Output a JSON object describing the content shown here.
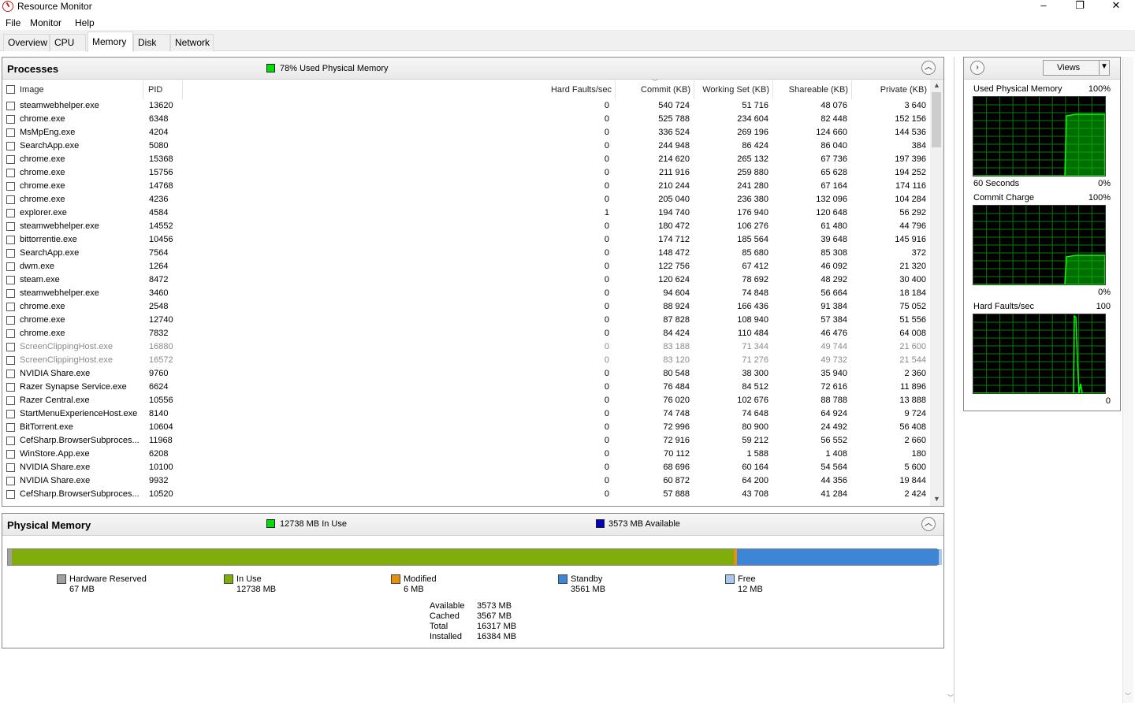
{
  "app": {
    "title": "Resource Monitor"
  },
  "window_controls": {
    "minimize": "–",
    "maximize": "❐",
    "close": "✕"
  },
  "menu": [
    "File",
    "Monitor",
    "Help"
  ],
  "tabs": [
    "Overview",
    "CPU",
    "Memory",
    "Disk",
    "Network"
  ],
  "active_tab": "Memory",
  "processes": {
    "title": "Processes",
    "status_text": "78% Used Physical Memory",
    "status_color": "#00e000",
    "columns": {
      "image": "Image",
      "pid": "PID",
      "hard_faults": "Hard Faults/sec",
      "commit": "Commit (KB)",
      "working_set": "Working Set (KB)",
      "shareable": "Shareable (KB)",
      "private": "Private (KB)"
    },
    "rows": [
      {
        "image": "steamwebhelper.exe",
        "pid": "13620",
        "hf": "0",
        "commit": "540 724",
        "ws": "51 716",
        "share": "48 076",
        "priv": "3 640",
        "dim": false
      },
      {
        "image": "chrome.exe",
        "pid": "6348",
        "hf": "0",
        "commit": "525 788",
        "ws": "234 604",
        "share": "82 448",
        "priv": "152 156",
        "dim": false
      },
      {
        "image": "MsMpEng.exe",
        "pid": "4204",
        "hf": "0",
        "commit": "336 524",
        "ws": "269 196",
        "share": "124 660",
        "priv": "144 536",
        "dim": false
      },
      {
        "image": "SearchApp.exe",
        "pid": "5080",
        "hf": "0",
        "commit": "244 948",
        "ws": "86 424",
        "share": "86 040",
        "priv": "384",
        "dim": false
      },
      {
        "image": "chrome.exe",
        "pid": "15368",
        "hf": "0",
        "commit": "214 620",
        "ws": "265 132",
        "share": "67 736",
        "priv": "197 396",
        "dim": false
      },
      {
        "image": "chrome.exe",
        "pid": "15756",
        "hf": "0",
        "commit": "211 916",
        "ws": "259 880",
        "share": "65 628",
        "priv": "194 252",
        "dim": false
      },
      {
        "image": "chrome.exe",
        "pid": "14768",
        "hf": "0",
        "commit": "210 244",
        "ws": "241 280",
        "share": "67 164",
        "priv": "174 116",
        "dim": false
      },
      {
        "image": "chrome.exe",
        "pid": "4236",
        "hf": "0",
        "commit": "205 040",
        "ws": "236 380",
        "share": "132 096",
        "priv": "104 284",
        "dim": false
      },
      {
        "image": "explorer.exe",
        "pid": "4584",
        "hf": "1",
        "commit": "194 740",
        "ws": "176 940",
        "share": "120 648",
        "priv": "56 292",
        "dim": false
      },
      {
        "image": "steamwebhelper.exe",
        "pid": "14552",
        "hf": "0",
        "commit": "180 472",
        "ws": "106 276",
        "share": "61 480",
        "priv": "44 796",
        "dim": false
      },
      {
        "image": "bittorrentie.exe",
        "pid": "10456",
        "hf": "0",
        "commit": "174 712",
        "ws": "185 564",
        "share": "39 648",
        "priv": "145 916",
        "dim": false
      },
      {
        "image": "SearchApp.exe",
        "pid": "7564",
        "hf": "0",
        "commit": "148 472",
        "ws": "85 680",
        "share": "85 308",
        "priv": "372",
        "dim": false
      },
      {
        "image": "dwm.exe",
        "pid": "1264",
        "hf": "0",
        "commit": "122 756",
        "ws": "67 412",
        "share": "46 092",
        "priv": "21 320",
        "dim": false
      },
      {
        "image": "steam.exe",
        "pid": "8472",
        "hf": "0",
        "commit": "120 624",
        "ws": "78 692",
        "share": "48 292",
        "priv": "30 400",
        "dim": false
      },
      {
        "image": "steamwebhelper.exe",
        "pid": "3460",
        "hf": "0",
        "commit": "94 604",
        "ws": "74 848",
        "share": "56 664",
        "priv": "18 184",
        "dim": false
      },
      {
        "image": "chrome.exe",
        "pid": "2548",
        "hf": "0",
        "commit": "88 924",
        "ws": "166 436",
        "share": "91 384",
        "priv": "75 052",
        "dim": false
      },
      {
        "image": "chrome.exe",
        "pid": "12740",
        "hf": "0",
        "commit": "87 828",
        "ws": "108 940",
        "share": "57 384",
        "priv": "51 556",
        "dim": false
      },
      {
        "image": "chrome.exe",
        "pid": "7832",
        "hf": "0",
        "commit": "84 424",
        "ws": "110 484",
        "share": "46 476",
        "priv": "64 008",
        "dim": false
      },
      {
        "image": "ScreenClippingHost.exe",
        "pid": "16880",
        "hf": "0",
        "commit": "83 188",
        "ws": "71 344",
        "share": "49 744",
        "priv": "21 600",
        "dim": true
      },
      {
        "image": "ScreenClippingHost.exe",
        "pid": "16572",
        "hf": "0",
        "commit": "83 120",
        "ws": "71 276",
        "share": "49 732",
        "priv": "21 544",
        "dim": true
      },
      {
        "image": "NVIDIA Share.exe",
        "pid": "9760",
        "hf": "0",
        "commit": "80 548",
        "ws": "38 300",
        "share": "35 940",
        "priv": "2 360",
        "dim": false
      },
      {
        "image": "Razer Synapse Service.exe",
        "pid": "6624",
        "hf": "0",
        "commit": "76 484",
        "ws": "84 512",
        "share": "72 616",
        "priv": "11 896",
        "dim": false
      },
      {
        "image": "Razer Central.exe",
        "pid": "10556",
        "hf": "0",
        "commit": "76 020",
        "ws": "102 676",
        "share": "88 788",
        "priv": "13 888",
        "dim": false
      },
      {
        "image": "StartMenuExperienceHost.exe",
        "pid": "8140",
        "hf": "0",
        "commit": "74 748",
        "ws": "74 648",
        "share": "64 924",
        "priv": "9 724",
        "dim": false
      },
      {
        "image": "BitTorrent.exe",
        "pid": "10604",
        "hf": "0",
        "commit": "72 996",
        "ws": "80 900",
        "share": "24 492",
        "priv": "56 408",
        "dim": false
      },
      {
        "image": "CefSharp.BrowserSubproces...",
        "pid": "11968",
        "hf": "0",
        "commit": "72 916",
        "ws": "59 212",
        "share": "56 552",
        "priv": "2 660",
        "dim": false
      },
      {
        "image": "WinStore.App.exe",
        "pid": "6208",
        "hf": "0",
        "commit": "70 112",
        "ws": "1 588",
        "share": "1 408",
        "priv": "180",
        "dim": false
      },
      {
        "image": "NVIDIA Share.exe",
        "pid": "10100",
        "hf": "0",
        "commit": "68 696",
        "ws": "60 164",
        "share": "54 564",
        "priv": "5 600",
        "dim": false
      },
      {
        "image": "NVIDIA Share.exe",
        "pid": "9932",
        "hf": "0",
        "commit": "60 872",
        "ws": "64 200",
        "share": "44 356",
        "priv": "19 844",
        "dim": false
      },
      {
        "image": "CefSharp.BrowserSubproces...",
        "pid": "10520",
        "hf": "0",
        "commit": "57 888",
        "ws": "43 708",
        "share": "41 284",
        "priv": "2 424",
        "dim": false
      }
    ]
  },
  "physical_memory": {
    "title": "Physical Memory",
    "in_use_text": "12738 MB In Use",
    "in_use_color": "#00e000",
    "available_text": "3573 MB Available",
    "available_color": "#0000c0",
    "segments": [
      {
        "label": "Hardware Reserved",
        "value_text": "67 MB",
        "mb": 67,
        "color": "#a0a0a0"
      },
      {
        "label": "In Use",
        "value_text": "12738 MB",
        "mb": 12738,
        "color": "#7fae0a"
      },
      {
        "label": "Modified",
        "value_text": "6 MB",
        "mb": 6,
        "color": "#e8900c"
      },
      {
        "label": "Standby",
        "value_text": "3561 MB",
        "mb": 3561,
        "color": "#3d85d6"
      },
      {
        "label": "Free",
        "value_text": "12 MB",
        "mb": 12,
        "color": "#a9c8ef"
      }
    ],
    "stats": [
      {
        "label": "Available",
        "value": "3573 MB"
      },
      {
        "label": "Cached",
        "value": "3567 MB"
      },
      {
        "label": "Total",
        "value": "16317 MB"
      },
      {
        "label": "Installed",
        "value": "16384 MB"
      }
    ]
  },
  "graphs_panel": {
    "views_label": "Views",
    "graphs": [
      {
        "title": "Used Physical Memory",
        "max_label": "100%",
        "min_label": "0%",
        "time_label": "60 Seconds",
        "level": 0.78
      },
      {
        "title": "Commit Charge",
        "max_label": "100%",
        "min_label": "0%",
        "time_label": "",
        "level": 0.37
      },
      {
        "title": "Hard Faults/sec",
        "max_label": "100",
        "min_label": "0",
        "time_label": "",
        "level": 0.98
      }
    ]
  }
}
